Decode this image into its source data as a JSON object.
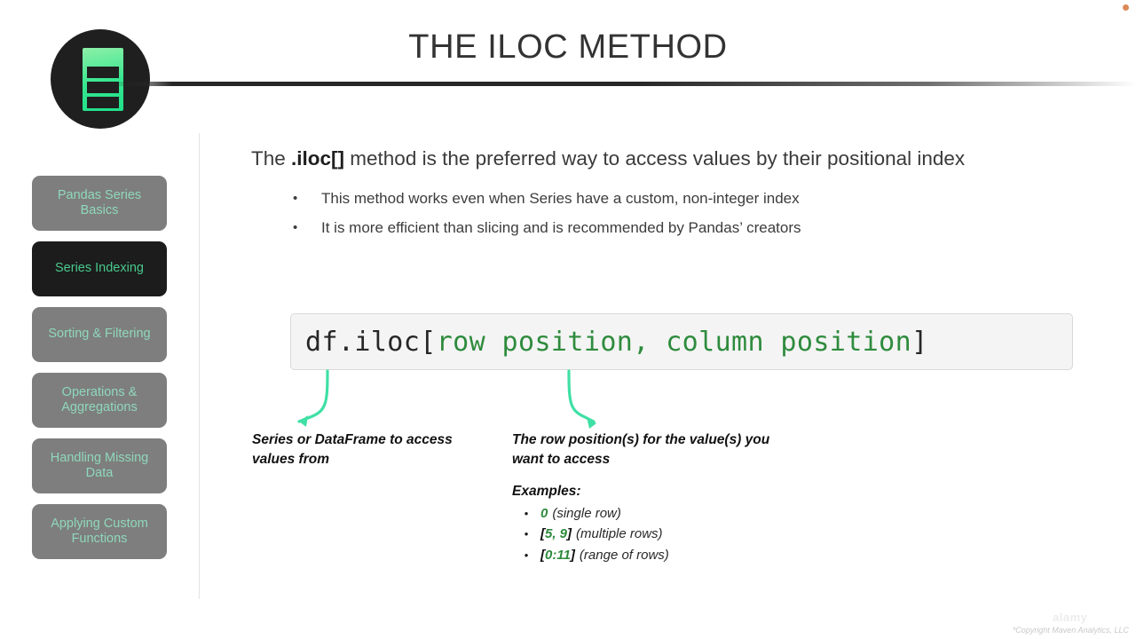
{
  "slide": {
    "title": "THE ILOC METHOD",
    "corner_dot_color": "#d3743a",
    "accent_green": "#2e8b3d",
    "arrow_green": "#3fe0a5"
  },
  "logo": {
    "name": "maven-analytics-logo",
    "circle_color": "#1f1f1f",
    "mark_gradient_from": "#8df0a8",
    "mark_gradient_to": "#1fe08a"
  },
  "sidebar": {
    "items": [
      {
        "label": "Pandas Series Basics",
        "active": false
      },
      {
        "label": "Series Indexing",
        "active": true
      },
      {
        "label": "Sorting & Filtering",
        "active": false
      },
      {
        "label": "Operations & Aggregations",
        "active": false
      },
      {
        "label": "Handling Missing Data",
        "active": false
      },
      {
        "label": "Applying Custom Functions",
        "active": false
      }
    ]
  },
  "main": {
    "lede_before": "The ",
    "lede_bold": ".iloc[]",
    "lede_after": " method is the preferred way to access values by their positional index",
    "bullet_marker": "•",
    "bullets": [
      "This method works even when Series have a custom, non-integer index",
      "It is more efficient than slicing and is recommended by Pandas’ creators"
    ],
    "code": {
      "prefix": "df.iloc[",
      "arg1": "row position",
      "separator": ", ",
      "arg2": "column position",
      "suffix": "]"
    },
    "callout_left": "Series or DataFrame to access values from",
    "callout_right": "The row position(s) for the value(s) you want to access",
    "examples": {
      "title": "Examples:",
      "marker": "•",
      "rows": [
        {
          "code_open": "",
          "code_num": "0",
          "code_close": "",
          "note": "(single row)"
        },
        {
          "code_open": "[",
          "code_num": "5, 9",
          "code_close": "]",
          "note": "(multiple rows)"
        },
        {
          "code_open": "[",
          "code_num": "0:11",
          "code_close": "]",
          "note": "(range of rows)"
        }
      ]
    }
  },
  "footer": {
    "watermark": "alamy",
    "copyright": "*Copyright Maven Analytics, LLC"
  }
}
